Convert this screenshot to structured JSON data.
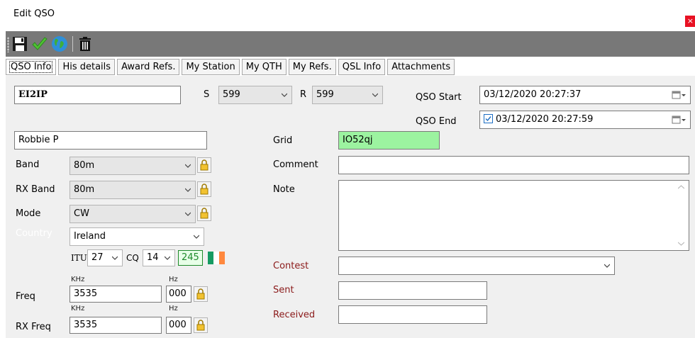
{
  "window": {
    "title": "Edit QSO",
    "close_label": "×"
  },
  "toolbar": {
    "icons": [
      "save-icon",
      "checkmark-icon",
      "globe-icon",
      "trash-icon"
    ]
  },
  "tabs": [
    {
      "label": "QSO Info",
      "active": true
    },
    {
      "label": "His details"
    },
    {
      "label": "Award Refs."
    },
    {
      "label": "My Station"
    },
    {
      "label": "My QTH"
    },
    {
      "label": "My Refs."
    },
    {
      "label": "QSL Info"
    },
    {
      "label": "Attachments"
    }
  ],
  "qso": {
    "callsign": "EI2IP",
    "s_label": "S",
    "s_value": "599",
    "r_label": "R",
    "r_value": "599",
    "start_label": "QSO Start",
    "start_value": "03/12/2020 20:27:37",
    "end_label": "QSO End",
    "end_value": "03/12/2020 20:27:59",
    "end_checked": true
  },
  "left": {
    "name": "Robbie P",
    "band_label": "Band",
    "band_value": "80m",
    "rxband_label": "RX Band",
    "rxband_value": "80m",
    "mode_label": "Mode",
    "mode_value": "CW",
    "country_label": "Country",
    "country_value": "Ireland",
    "itu_label": "ITU",
    "itu_value": "27",
    "cq_label": "CQ",
    "cq_value": "14",
    "dxcc": "245",
    "khz_label": "KHz",
    "hz_label": "Hz",
    "freq_label": "Freq",
    "freq_khz": "3535",
    "freq_hz": "000",
    "rxfreq_label": "RX Freq",
    "rxfreq_khz": "3535",
    "rxfreq_hz": "000"
  },
  "right": {
    "grid_label": "Grid",
    "grid_value": "IO52qj",
    "comment_label": "Comment",
    "comment_value": "",
    "note_label": "Note",
    "note_value": "",
    "contest_label": "Contest",
    "contest_value": "",
    "sent_label": "Sent",
    "sent_value": "",
    "received_label": "Received",
    "received_value": ""
  },
  "colors": {
    "toolbar_bg": "#787878",
    "grid_bg": "#9cf3a0",
    "contest_label": "#8b1a1a",
    "flag": [
      "#169b62",
      "#ffffff",
      "#ff883e"
    ]
  }
}
